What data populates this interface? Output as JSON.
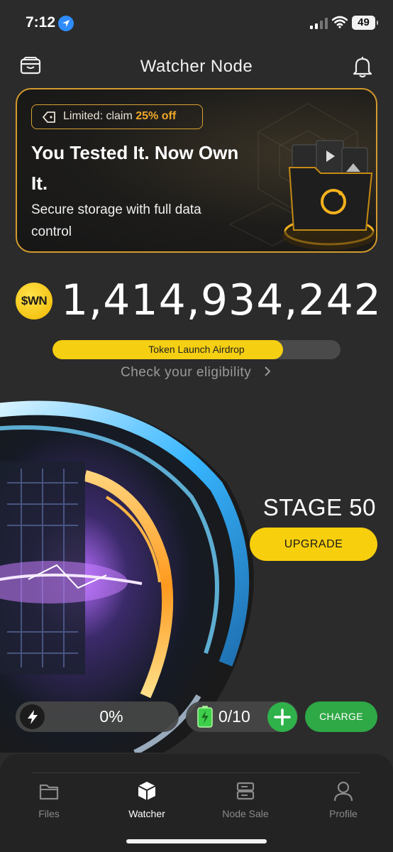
{
  "status_bar": {
    "time": "7:12",
    "battery": "49",
    "icons": [
      "location-arrow-icon",
      "cellular-signal-icon",
      "wifi-icon",
      "battery-icon"
    ]
  },
  "header": {
    "title": "Watcher Node",
    "left_icon": "wallet-icon",
    "right_icon": "bell-icon"
  },
  "promo": {
    "badge_prefix": "Limited: claim ",
    "badge_highlight": "25% off",
    "title": "You Tested It. Now Own It.",
    "subtitle": "Secure storage with full data control",
    "border_color": "#d39a2a",
    "accent_color": "#f0a728"
  },
  "balance": {
    "coin_label": "$WN",
    "amount": "1,414,934,242"
  },
  "airdrop": {
    "label": "Token Launch Airdrop",
    "progress_fraction": 0.8,
    "link": "Check your eligibility",
    "fill_color": "#f5cf12"
  },
  "stage": {
    "label": "STAGE 50",
    "upgrade": "UPGRADE",
    "button_color": "#f7cf0d"
  },
  "controls": {
    "energy_value": "0%",
    "battery_value": "0/10",
    "charge": "CHARGE",
    "green": "#2fa846"
  },
  "tabbar": {
    "tabs": [
      {
        "label": "Files",
        "icon": "folder-icon",
        "active": false
      },
      {
        "label": "Watcher",
        "icon": "cube-icon",
        "active": true
      },
      {
        "label": "Node Sale",
        "icon": "server-icon",
        "active": false
      },
      {
        "label": "Profile",
        "icon": "user-icon",
        "active": false
      }
    ]
  }
}
